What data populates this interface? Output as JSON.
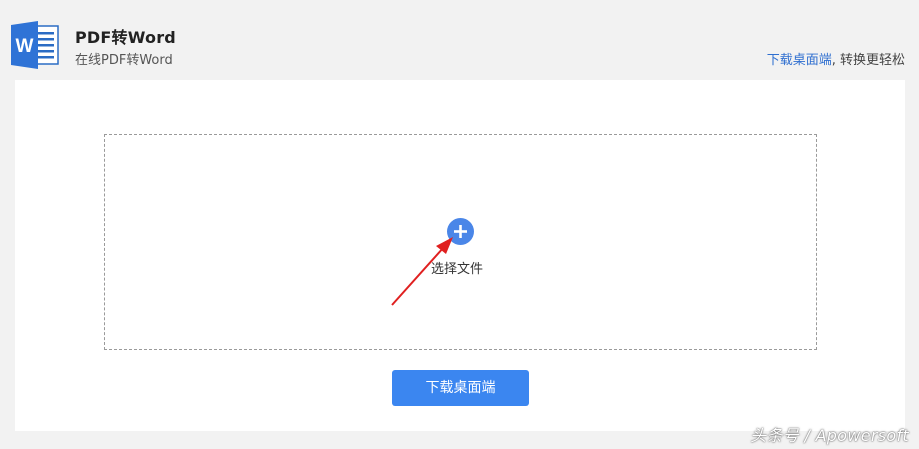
{
  "header": {
    "logo_icon": "word-document-icon",
    "logo_letter": "W",
    "title": "PDF转Word",
    "subtitle": "在线PDF转Word",
    "promo_link": "下载桌面端",
    "promo_text": ", 转换更轻松"
  },
  "upload": {
    "add_icon": "plus-icon",
    "label": "选择文件"
  },
  "download_button": "下载桌面端",
  "watermark": "头条号 / Apowersoft",
  "colors": {
    "accent": "#4a86e8",
    "button": "#3b86f0",
    "link": "#2f6fd0",
    "annotation_arrow": "#e02020",
    "page_background": "#f2f2f2"
  }
}
